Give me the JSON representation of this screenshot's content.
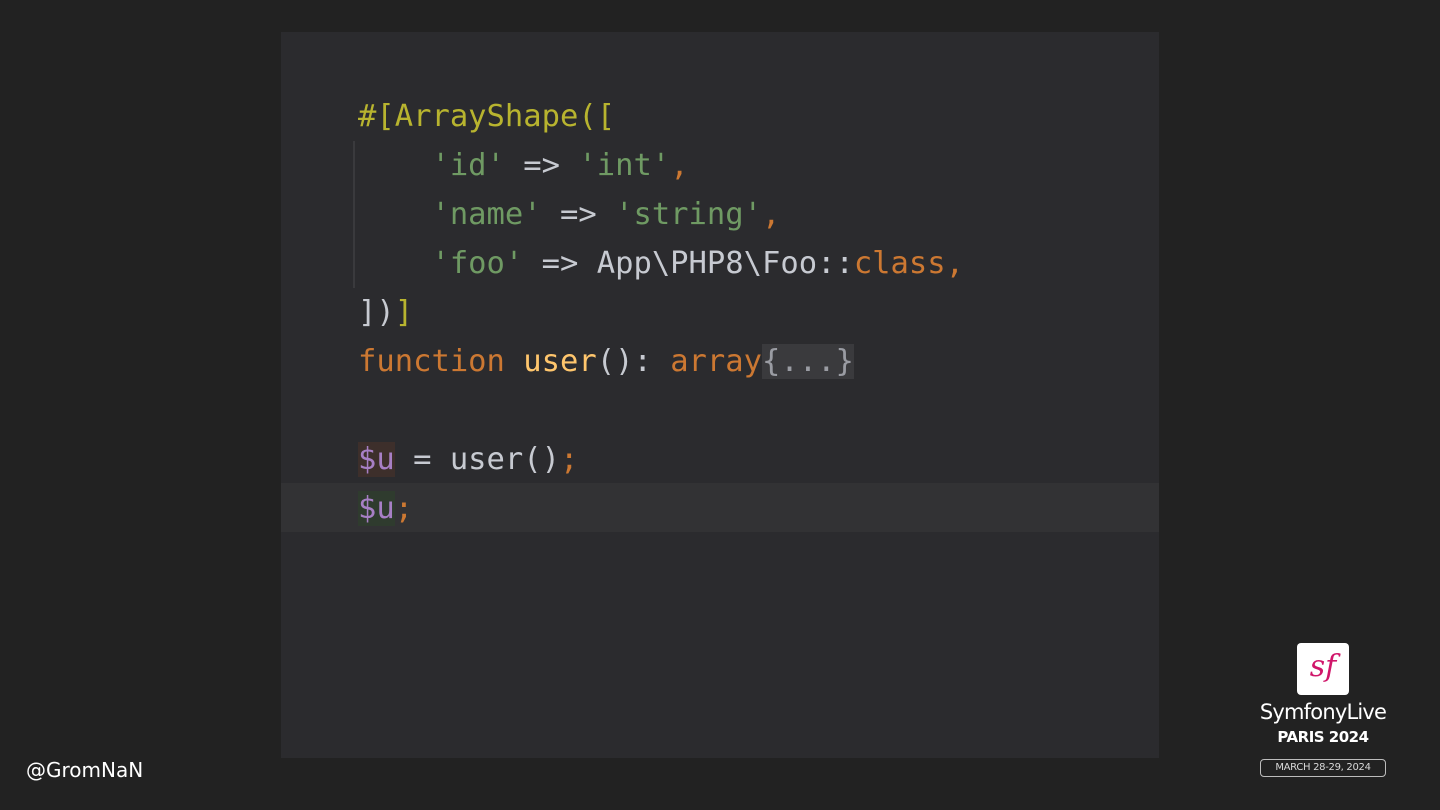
{
  "code": {
    "line1": {
      "attr": "#[ArrayShape([",
      "suffix": ""
    },
    "line2": {
      "key": "'id'",
      "arrow": " => ",
      "value": "'int'",
      "comma": ","
    },
    "line3": {
      "key": "'name'",
      "arrow": " => ",
      "value": "'string'",
      "comma": ","
    },
    "line4": {
      "key": "'foo'",
      "arrow": " => ",
      "cls": "App\\PHP8\\Foo::",
      "kw": "class",
      "comma": ","
    },
    "line5": {
      "close_a": "])",
      "close_b": "]"
    },
    "line6": {
      "kw": "function",
      "fn": "user",
      "sig": "(): ",
      "ret": "array",
      "fold": "{...}"
    },
    "line8": {
      "var": "$u",
      "assign": " = user()",
      "semi": ";"
    },
    "line9": {
      "var": "$u",
      "semi": ";"
    }
  },
  "footer": {
    "handle": "@GromNaN",
    "brand_name": "SymfonyLive",
    "brand_city": "PARIS 2024",
    "brand_dates": "MARCH 28-29, 2024",
    "logo_letter": "sf"
  },
  "colors": {
    "attribute": "#b8b42f",
    "string": "#6f9a63",
    "keyword": "#cc7832",
    "function": "#ffc66d",
    "variable": "#a77fc5",
    "brand": "#d0166a"
  }
}
